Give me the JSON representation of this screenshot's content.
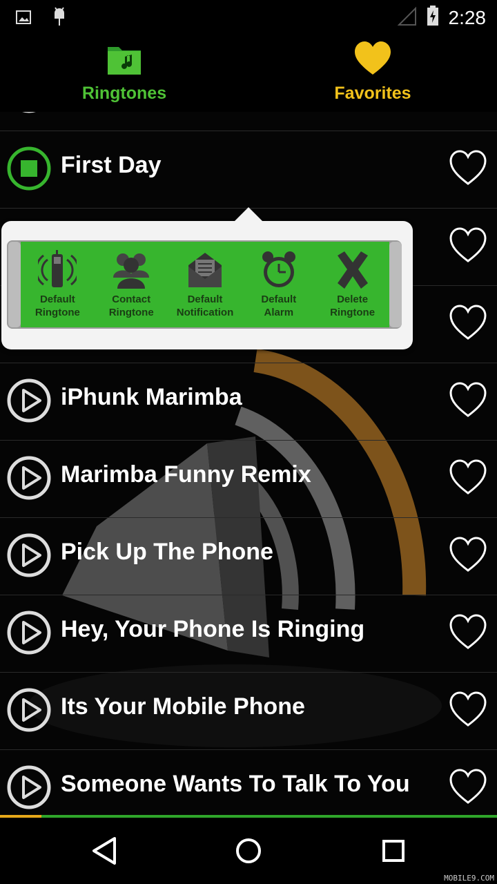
{
  "status_bar": {
    "time": "2:28",
    "left_icons": [
      "image-icon",
      "android-icon"
    ],
    "right_icons": [
      "signal-icon",
      "battery-charging-icon"
    ]
  },
  "tabs": [
    {
      "label": "Ringtones",
      "icon": "music-folder-icon",
      "color": "#4fc236",
      "selected": true
    },
    {
      "label": "Favorites",
      "icon": "heart-icon",
      "color": "#f2c21b",
      "selected": false
    }
  ],
  "ringtones": [
    {
      "title": "First Day",
      "state": "playing"
    },
    {
      "title": "",
      "state": "hidden-by-menu"
    },
    {
      "title": "",
      "state": "hidden-by-menu"
    },
    {
      "title": "iPhunk Marimba",
      "state": "stopped"
    },
    {
      "title": "Marimba Funny Remix",
      "state": "stopped"
    },
    {
      "title": "Pick Up The Phone",
      "state": "stopped"
    },
    {
      "title": "Hey, Your Phone Is Ringing",
      "state": "stopped"
    },
    {
      "title": "Its Your Mobile Phone",
      "state": "stopped"
    },
    {
      "title": "Someone Wants To Talk To You",
      "state": "stopped"
    }
  ],
  "action_menu": {
    "items": [
      {
        "line1": "Default",
        "line2": "Ringtone",
        "icon": "phone-icon"
      },
      {
        "line1": "Contact",
        "line2": "Ringtone",
        "icon": "contacts-icon"
      },
      {
        "line1": "Default",
        "line2": "Notification",
        "icon": "envelope-icon"
      },
      {
        "line1": "Default",
        "line2": "Alarm",
        "icon": "alarm-clock-icon"
      },
      {
        "line1": "Delete",
        "line2": "Ringtone",
        "icon": "delete-x-icon"
      }
    ]
  },
  "navigation": [
    "back-icon",
    "home-icon",
    "recents-icon"
  ],
  "watermark": "MOBILE9.COM",
  "colors": {
    "accent_green": "#37b52e",
    "favorites_yellow": "#f2c21b",
    "background": "#000000"
  }
}
